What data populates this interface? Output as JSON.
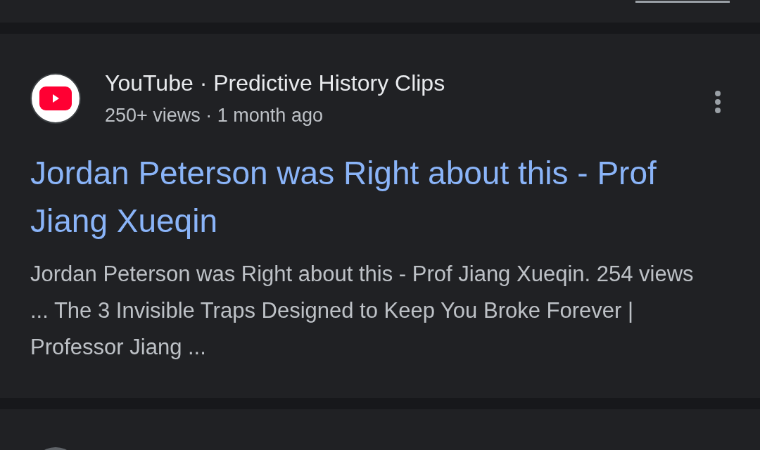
{
  "result": {
    "source": "YouTube · Predictive History Clips",
    "meta": "250+ views · 1 month ago",
    "title": "Jordan Peterson was Right about this - Prof Jiang Xueqin",
    "snippet": "Jordan Peterson was Right about this - Prof Jiang Xueqin. 254 views ... The 3 Invisible Traps Designed to Keep You Broke Forever | Professor Jiang ..."
  }
}
